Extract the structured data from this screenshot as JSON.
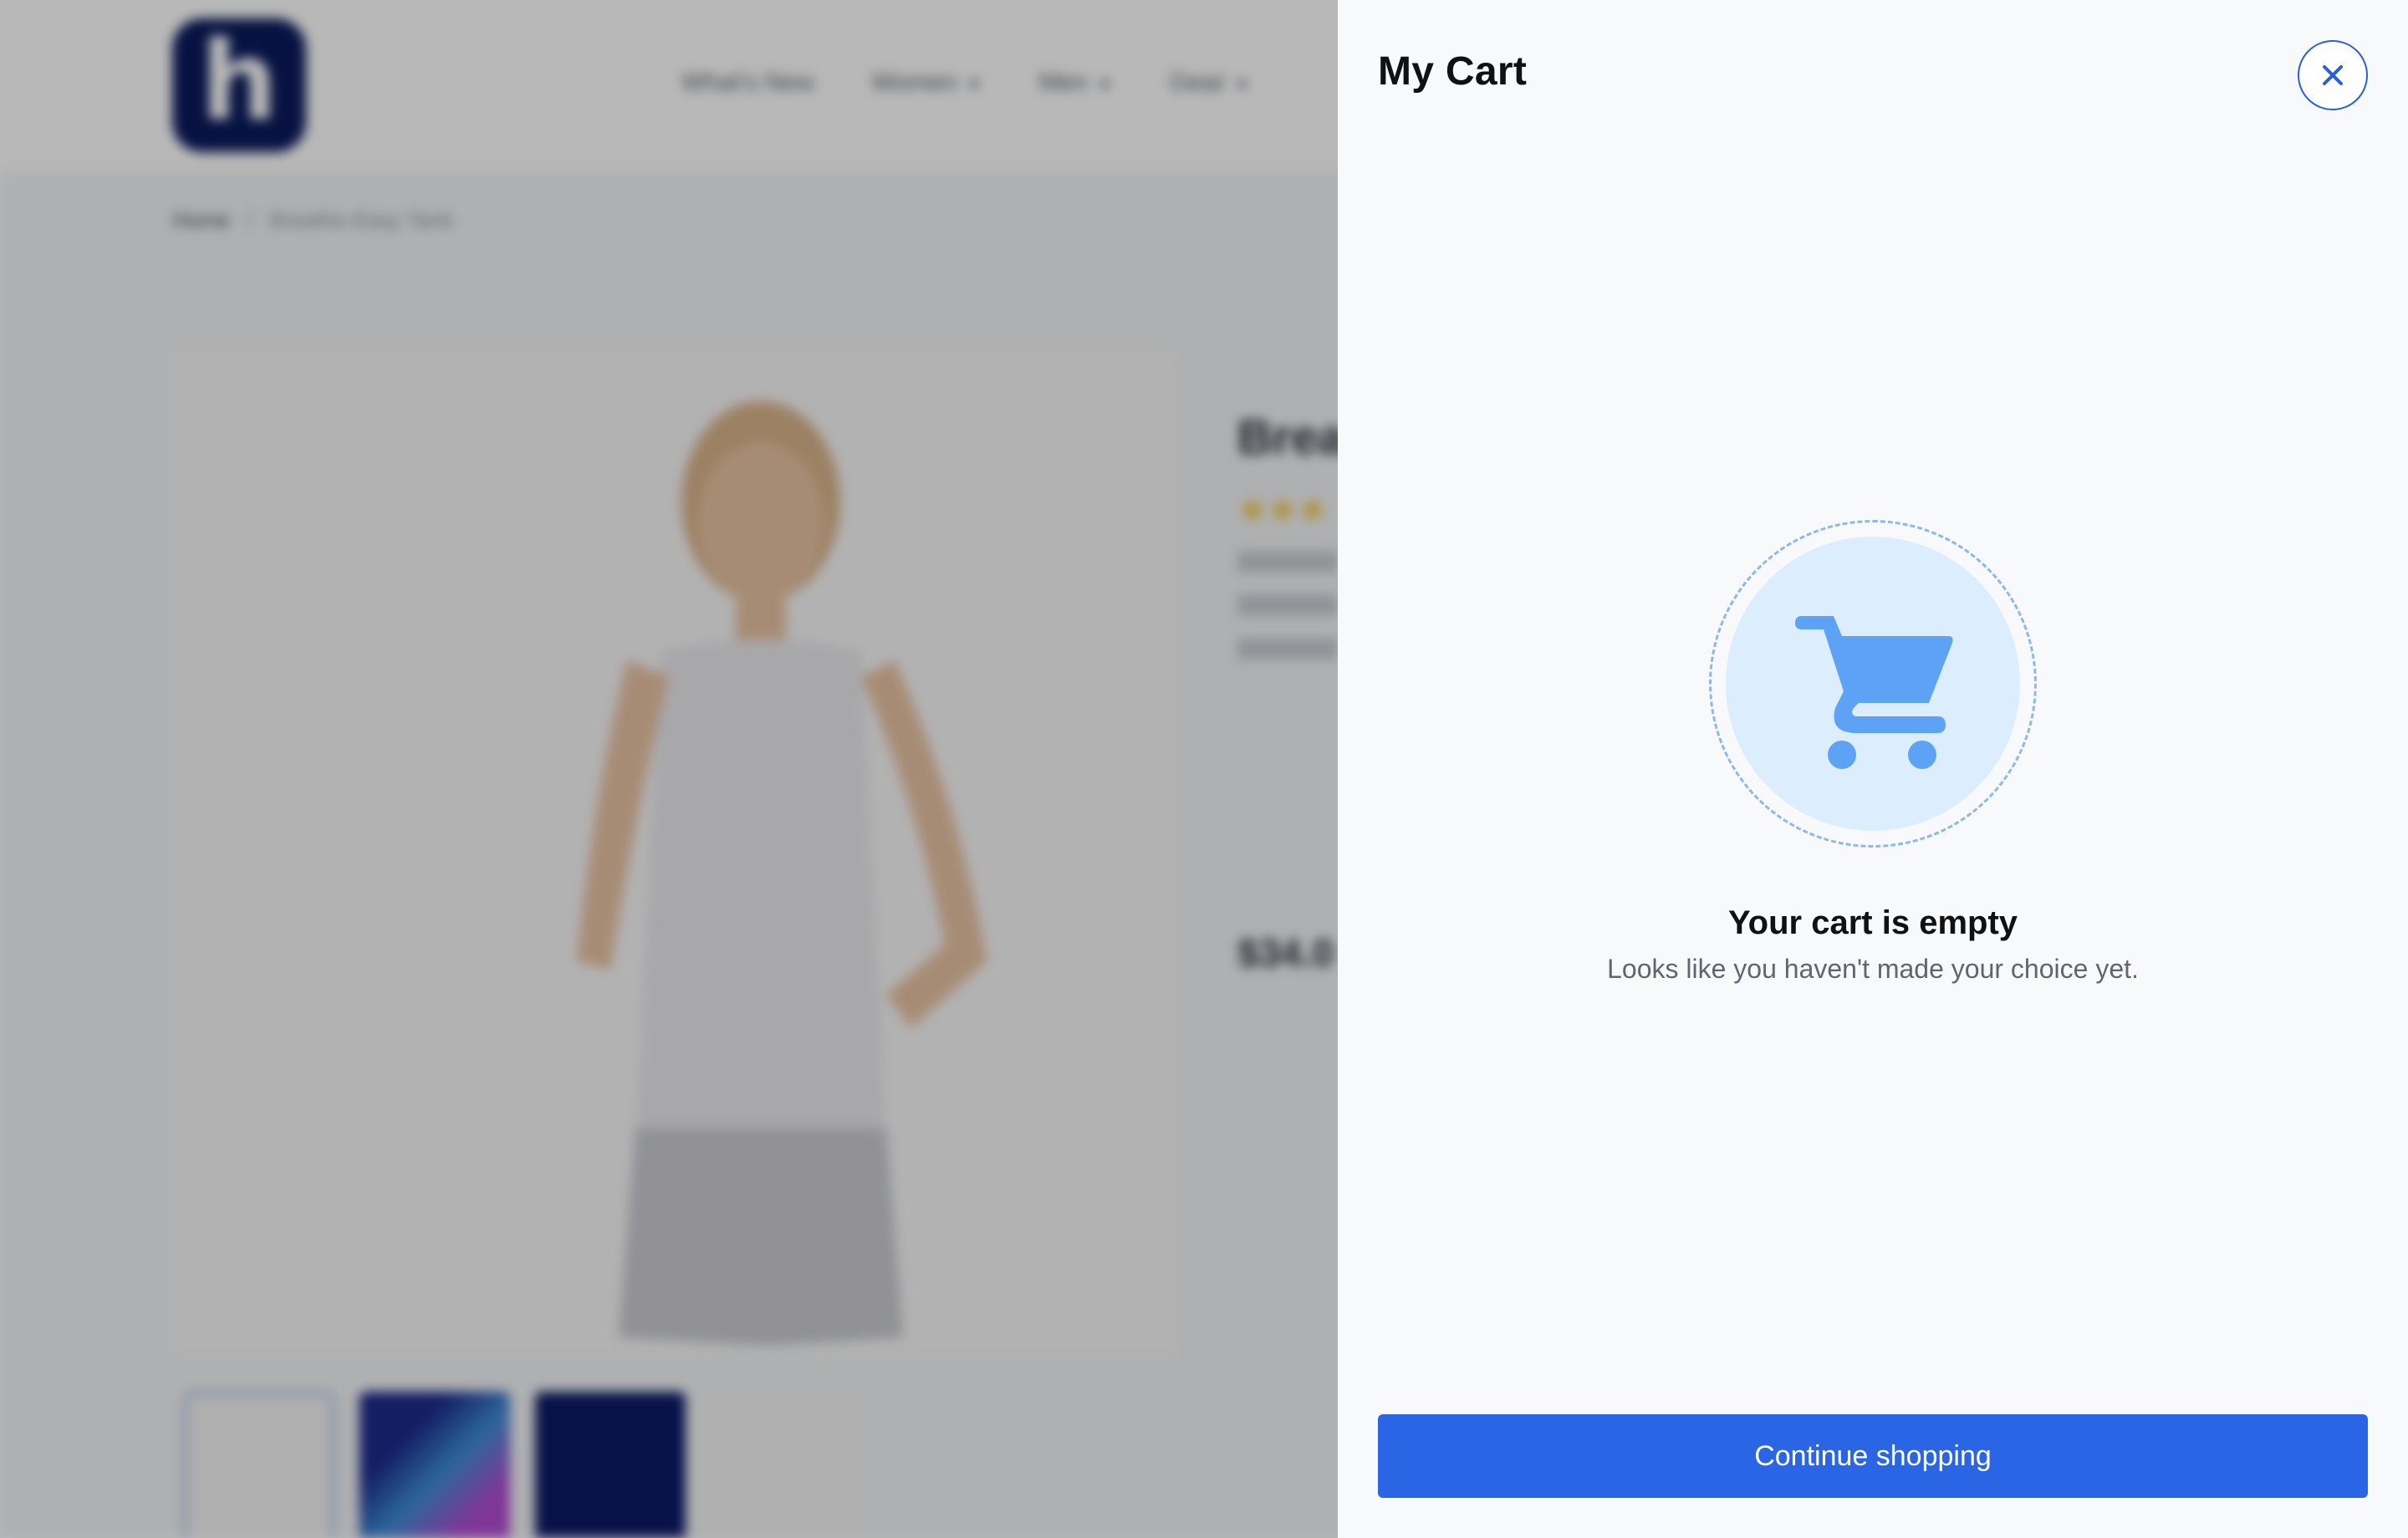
{
  "background_page": {
    "logo_text": "h",
    "nav": [
      "What's New",
      "Women",
      "Men",
      "Gear"
    ],
    "breadcrumb": [
      "Home",
      "Breathe-Easy Tank"
    ],
    "product_title": "Brea",
    "price": "$34.0"
  },
  "cart": {
    "title": "My Cart",
    "close_icon": "close-icon",
    "cart_icon": "shopping-cart-icon",
    "empty_title": "Your cart is empty",
    "empty_subtitle": "Looks like you haven't made your choice yet.",
    "continue_label": "Continue shopping"
  },
  "colors": {
    "accent": "#2a65e5",
    "cart_icon": "#5ea2f5",
    "cart_circle": "#dcedfd",
    "overlay": "rgba(0,0,0,0.28)"
  }
}
